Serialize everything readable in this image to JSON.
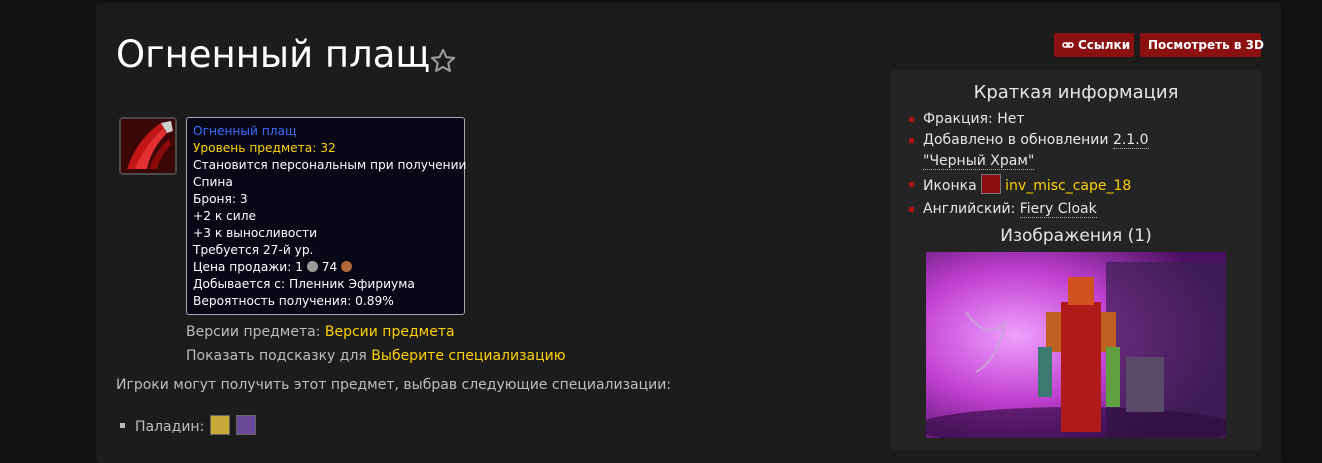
{
  "page": {
    "title": "Огненный плащ",
    "icon_names": {
      "favorite": "star-outline-icon",
      "links": "link-icon",
      "item": "inv-misc-cape-18-icon"
    }
  },
  "buttons": {
    "links": "Ссылки",
    "view3d": "Посмотреть в 3D"
  },
  "tooltip": {
    "name": "Огненный плащ",
    "level_label": "Уровень предмета: 32",
    "bind": "Становится персональным при получении",
    "slot": "Спина",
    "armor": "Броня: 3",
    "stat1": "+2 к силе",
    "stat2": "+3 к выносливости",
    "req": "Требуется 27-й ур.",
    "sell_prefix": "Цена продажи: ",
    "sell_silver": "1",
    "sell_copper": "74",
    "drop": "Добывается с: Пленник Эфириума",
    "chance": "Вероятность получения: 0.89%"
  },
  "meta": {
    "versions_label": "Версии предмета: ",
    "versions_link": "Версии предмета",
    "tooltip_label": "Показать подсказку для ",
    "tooltip_link": "Выберите специализацию"
  },
  "specs": {
    "intro": "Игроки могут получить этот предмет, выбрав следующие специализации:",
    "items": [
      {
        "label": "Паладин:"
      }
    ]
  },
  "infobox": {
    "title": "Краткая информация",
    "faction": "Фракция: Нет",
    "added_prefix": "Добавлено в обновлении ",
    "added_link": "2.1.0 \"Черный Храм\"",
    "icon_label": "Иконка ",
    "icon_name": "inv_misc_cape_18",
    "english_label": "Английский: ",
    "english_value": "Fiery Cloak",
    "images_title": "Изображения (1)"
  },
  "colors": {
    "accent": "#8b1010",
    "link": "#ffd100",
    "item_name": "#3b6cff",
    "bullet": "#b01010"
  }
}
